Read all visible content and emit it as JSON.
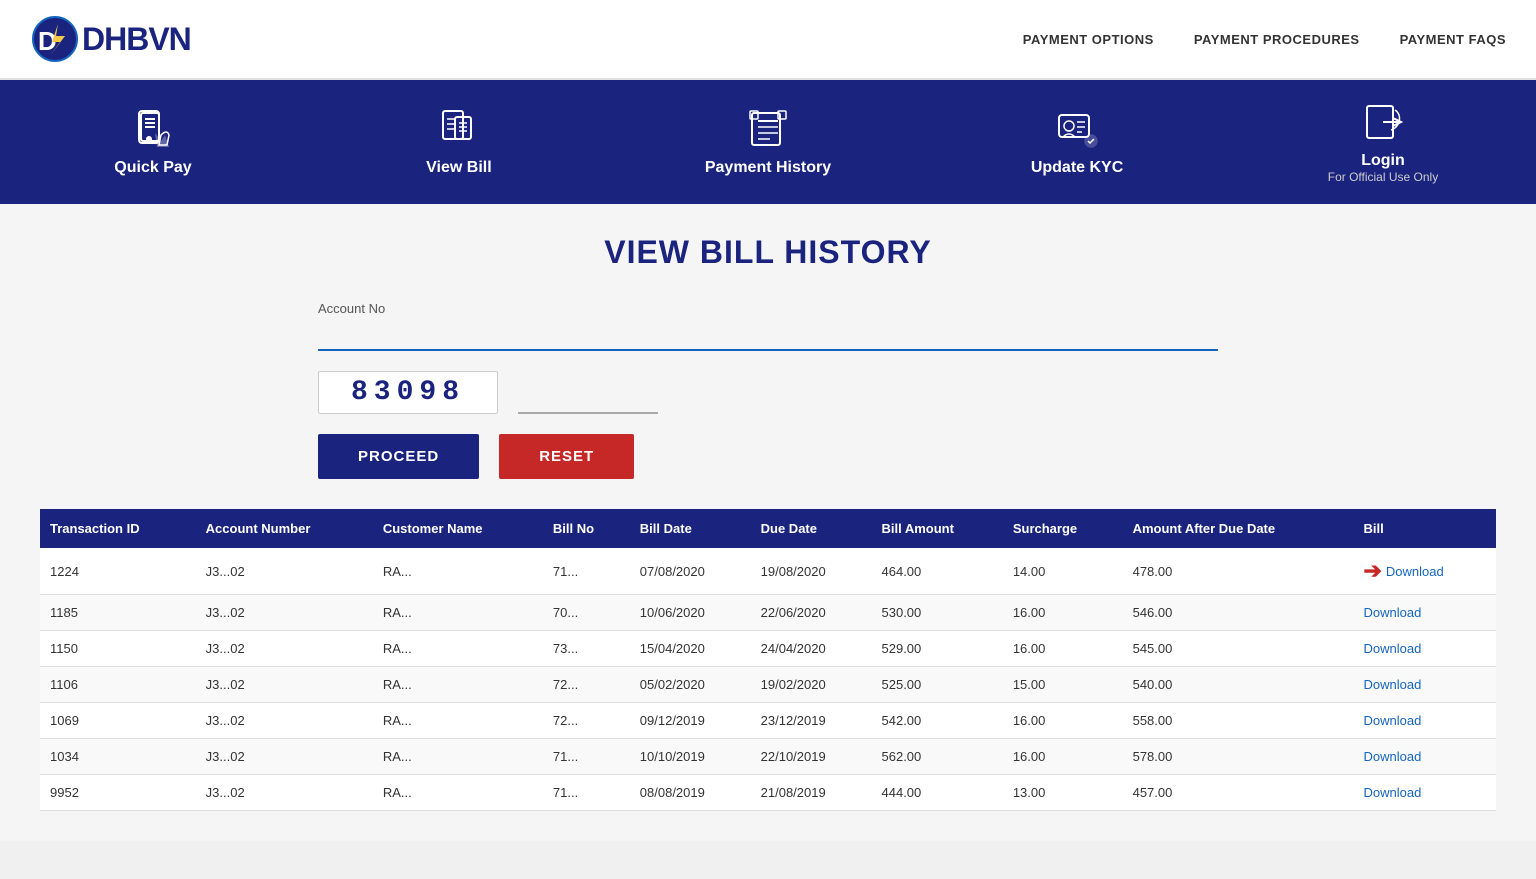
{
  "header": {
    "logo_text": "DHBVN",
    "nav_items": [
      {
        "label": "PAYMENT OPTIONS",
        "name": "payment-options-nav"
      },
      {
        "label": "PAYMENT PROCEDURES",
        "name": "payment-procedures-nav"
      },
      {
        "label": "PAYMENT FAQS",
        "name": "payment-faqs-nav"
      }
    ]
  },
  "banner": {
    "items": [
      {
        "label": "Quick Pay",
        "sublabel": "",
        "name": "quick-pay-banner"
      },
      {
        "label": "View Bill",
        "sublabel": "",
        "name": "view-bill-banner"
      },
      {
        "label": "Payment History",
        "sublabel": "",
        "name": "payment-history-banner"
      },
      {
        "label": "Update KYC",
        "sublabel": "",
        "name": "update-kyc-banner"
      },
      {
        "label": "Login",
        "sublabel": "For Official Use Only",
        "name": "login-banner"
      }
    ]
  },
  "main": {
    "title": "VIEW BILL HISTORY",
    "form": {
      "account_label": "Account No",
      "account_placeholder": "",
      "captcha_value": "83098",
      "captcha_input_placeholder": "",
      "proceed_label": "PROCEED",
      "reset_label": "RESET"
    },
    "table": {
      "columns": [
        "Transaction ID",
        "Account Number",
        "Customer Name",
        "Bill No",
        "Bill Date",
        "Due Date",
        "Bill Amount",
        "Surcharge",
        "Amount After Due Date",
        "Bill"
      ],
      "rows": [
        {
          "transaction_id": "1224",
          "account_number": "J3...02",
          "customer_name": "RA...",
          "bill_no": "71...",
          "bill_date": "07/08/2020",
          "due_date": "19/08/2020",
          "bill_amount": "464.00",
          "surcharge": "14.00",
          "amount_after_due": "478.00",
          "bill_action": "Download",
          "arrow": true
        },
        {
          "transaction_id": "1185",
          "account_number": "J3...02",
          "customer_name": "RA...",
          "bill_no": "70...",
          "bill_date": "10/06/2020",
          "due_date": "22/06/2020",
          "bill_amount": "530.00",
          "surcharge": "16.00",
          "amount_after_due": "546.00",
          "bill_action": "Download",
          "arrow": false
        },
        {
          "transaction_id": "1150",
          "account_number": "J3...02",
          "customer_name": "RA...",
          "bill_no": "73...",
          "bill_date": "15/04/2020",
          "due_date": "24/04/2020",
          "bill_amount": "529.00",
          "surcharge": "16.00",
          "amount_after_due": "545.00",
          "bill_action": "Download",
          "arrow": false
        },
        {
          "transaction_id": "1106",
          "account_number": "J3...02",
          "customer_name": "RA...",
          "bill_no": "72...",
          "bill_date": "05/02/2020",
          "due_date": "19/02/2020",
          "bill_amount": "525.00",
          "surcharge": "15.00",
          "amount_after_due": "540.00",
          "bill_action": "Download",
          "arrow": false
        },
        {
          "transaction_id": "1069",
          "account_number": "J3...02",
          "customer_name": "RA...",
          "bill_no": "72...",
          "bill_date": "09/12/2019",
          "due_date": "23/12/2019",
          "bill_amount": "542.00",
          "surcharge": "16.00",
          "amount_after_due": "558.00",
          "bill_action": "Download",
          "arrow": false
        },
        {
          "transaction_id": "1034",
          "account_number": "J3...02",
          "customer_name": "RA...",
          "bill_no": "71...",
          "bill_date": "10/10/2019",
          "due_date": "22/10/2019",
          "bill_amount": "562.00",
          "surcharge": "16.00",
          "amount_after_due": "578.00",
          "bill_action": "Download",
          "arrow": false
        },
        {
          "transaction_id": "9952",
          "account_number": "J3...02",
          "customer_name": "RA...",
          "bill_no": "71...",
          "bill_date": "08/08/2019",
          "due_date": "21/08/2019",
          "bill_amount": "444.00",
          "surcharge": "13.00",
          "amount_after_due": "457.00",
          "bill_action": "Download",
          "arrow": false
        }
      ]
    }
  }
}
